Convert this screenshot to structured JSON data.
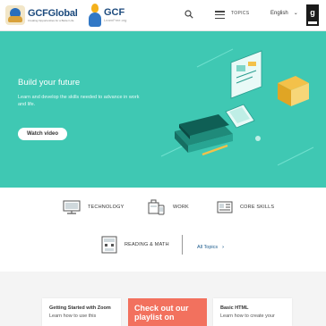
{
  "header": {
    "logo1_name": "GCFGlobal",
    "logo1_sub": "Creating Opportunities for a Better Life",
    "logo2_name": "GCF",
    "logo2_sub": "LearnFree.org",
    "topics_label": "TOPICS",
    "language": "English",
    "sponsor_letter": "g"
  },
  "hero": {
    "title": "Build your future",
    "subtitle": "Learn and develop the skills needed to advance in work and life.",
    "button_label": "Watch video",
    "bg_color": "#3fc8b3"
  },
  "topics": {
    "items": [
      {
        "label": "TECHNOLOGY",
        "icon": "monitor-icon"
      },
      {
        "label": "WORK",
        "icon": "briefcase-phone-icon"
      },
      {
        "label": "CORE SKILLS",
        "icon": "id-card-icon"
      },
      {
        "label": "READING & MATH",
        "icon": "calculator-book-icon"
      }
    ],
    "all_topics": "All Topics"
  },
  "cards": [
    {
      "title": "Getting Started with Zoom",
      "desc": "Learn how to use this"
    },
    {
      "title": "Basic HTML",
      "desc": "Learn how to create your"
    }
  ],
  "promo": {
    "text": "Check out our playlist on",
    "color": "#f2715e"
  }
}
